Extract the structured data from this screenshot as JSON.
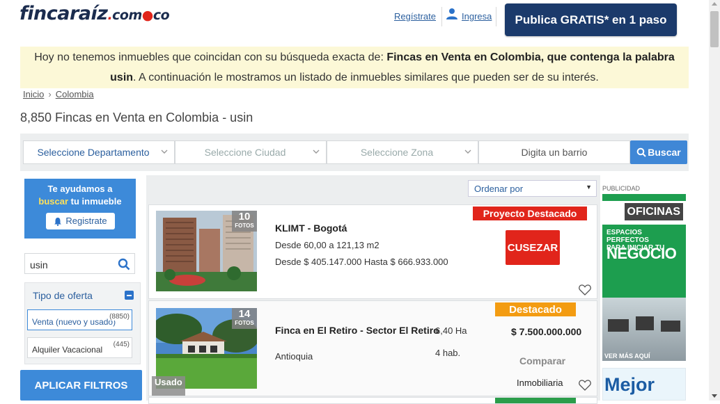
{
  "header": {
    "logo_main": "fincaraíz",
    "logo_com": "com",
    "logo_co": "co",
    "register_link": "Regístrate",
    "login_link": "Ingresa",
    "publish_button": "Publica GRATIS* en 1 paso"
  },
  "notice": {
    "text_a": "Hoy no tenemos inmuebles que coincidan con su búsqueda exacta de: ",
    "text_b": "Fincas en Venta en Colombia, que contenga la palabra usin",
    "text_c": ". A continuación le mostramos un listado de inmuebles similares que pueden ser de su interés."
  },
  "breadcrumb": {
    "items": [
      "Inicio",
      "Colombia"
    ],
    "separator": "›"
  },
  "page_title": "8,850 Fincas en Venta en Colombia - usin",
  "search": {
    "department": "Seleccione Departamento",
    "city": "Seleccione Ciudad",
    "zone": "Seleccione Zona",
    "barrio_placeholder": "Digita un barrio",
    "button": "Buscar"
  },
  "sidebar": {
    "help_line1": "Te ayudamos a",
    "help_link": "buscar",
    "help_line2": " tu inmueble",
    "register_button": "Registrate",
    "keyword_value": "usin",
    "filter_title": "Tipo de oferta",
    "options": [
      {
        "label": "Venta (nuevo y usado)",
        "count": "(8850)"
      },
      {
        "label": "Alquiler Vacacional",
        "count": "(445)"
      }
    ],
    "apply_button": "APLICAR FILTROS"
  },
  "results": {
    "order_label": "Ordenar por",
    "order_arrow": "▼",
    "cards": [
      {
        "photos_count": "10",
        "photos_label": "FOTOS",
        "ribbon": "Proyecto Destacado",
        "title": "KLIMT - Bogotá",
        "area": "Desde 60,00 a 121,13 m2",
        "price": "Desde $ 405.147.000 Hasta $ 666.933.000",
        "brand": "CUSEZAR"
      },
      {
        "photos_count": "14",
        "photos_label": "FOTOS",
        "condition": "Usado",
        "ribbon": "Destacado",
        "title": "Finca en El Retiro - Sector El Retiro",
        "area": "6,40 Ha",
        "location": "Antioquia",
        "rooms": "4 hab.",
        "price": "$ 7.500.000.000",
        "compare": "Comparar",
        "seller": "Inmobiliaria"
      }
    ]
  },
  "ads": {
    "label": "PUBLICIDAD",
    "ad1_title": "OFICINAS",
    "ad1_line1": "ESPACIOS PERFECTOS",
    "ad1_line2": "PARA INICIAR TU",
    "ad1_big": "NEGOCIO",
    "ad1_more": "VER MÁS AQUÍ",
    "ad2_text": "Mejor"
  },
  "colors": {
    "brand_navy": "#1b3a6b",
    "accent_blue": "#3d8ad9",
    "red": "#e1251b",
    "orange": "#f39c12",
    "notice_bg": "#fcf8d7"
  }
}
